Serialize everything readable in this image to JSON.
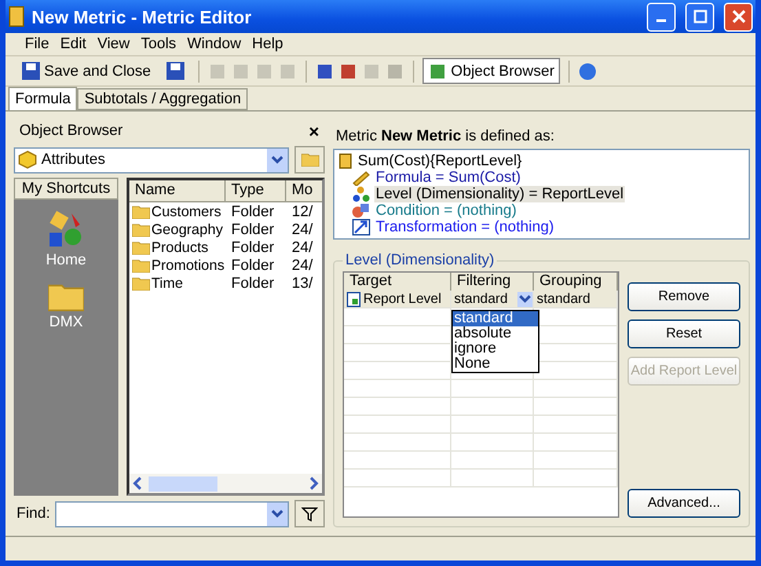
{
  "window": {
    "title": "New Metric - Metric Editor"
  },
  "menu": [
    "File",
    "Edit",
    "View",
    "Tools",
    "Window",
    "Help"
  ],
  "toolbar": {
    "save_label": "Save and Close",
    "object_browser": {
      "label": "Object Browser",
      "selected": true
    }
  },
  "tabs": [
    {
      "label": "Formula",
      "selected": true
    },
    {
      "label": "Subtotals / Aggregation",
      "selected": false
    }
  ],
  "object_browser": {
    "title": "Object Browser",
    "close": "×",
    "folder": "Attributes",
    "shortcuts_title": "My Shortcuts",
    "shortcuts": [
      {
        "label": "Home",
        "kind": "home"
      },
      {
        "label": "DMX",
        "kind": "folder"
      }
    ],
    "columns": [
      "Name",
      "Type",
      "Mo"
    ],
    "rows": [
      {
        "name": "Customers",
        "type": "Folder",
        "modified": "12/"
      },
      {
        "name": "Geography",
        "type": "Folder",
        "modified": "24/"
      },
      {
        "name": "Products",
        "type": "Folder",
        "modified": "24/"
      },
      {
        "name": "Promotions",
        "type": "Folder",
        "modified": "24/"
      },
      {
        "name": "Time",
        "type": "Folder",
        "modified": "13/"
      }
    ],
    "find_label": "Find:"
  },
  "definition": {
    "heading": "Metric **New Metric** is defined as:",
    "root": "Sum(Cost){ReportLevel}",
    "items": [
      {
        "label": "Formula = Sum(Cost)",
        "kind": "formula",
        "color": "#1a1aa6",
        "selected": false
      },
      {
        "label": "Level (Dimensionality) = ReportLevel",
        "kind": "level",
        "color": "#000000",
        "selected": true
      },
      {
        "label": "Condition = (nothing)",
        "kind": "condition",
        "color": "#167a8a",
        "selected": false
      },
      {
        "label": "Transformation = (nothing)",
        "kind": "transformation",
        "color": "#1a1aee",
        "selected": false
      }
    ]
  },
  "level": {
    "title": "Level (Dimensionality)",
    "columns": [
      "Target",
      "Filtering",
      "Grouping"
    ],
    "rows": [
      {
        "target": "Report Level",
        "filtering": "standard",
        "grouping": "standard"
      }
    ],
    "filter_options": [
      {
        "label": "standard",
        "selected": true
      },
      {
        "label": "absolute",
        "selected": false
      },
      {
        "label": "ignore",
        "selected": false
      },
      {
        "label": "None",
        "selected": false
      }
    ],
    "buttons": [
      {
        "label": "Remove",
        "disabled": false
      },
      {
        "label": "Reset",
        "disabled": false
      },
      {
        "label": "Add Report Level",
        "disabled": true
      }
    ],
    "advanced": "Advanced..."
  }
}
